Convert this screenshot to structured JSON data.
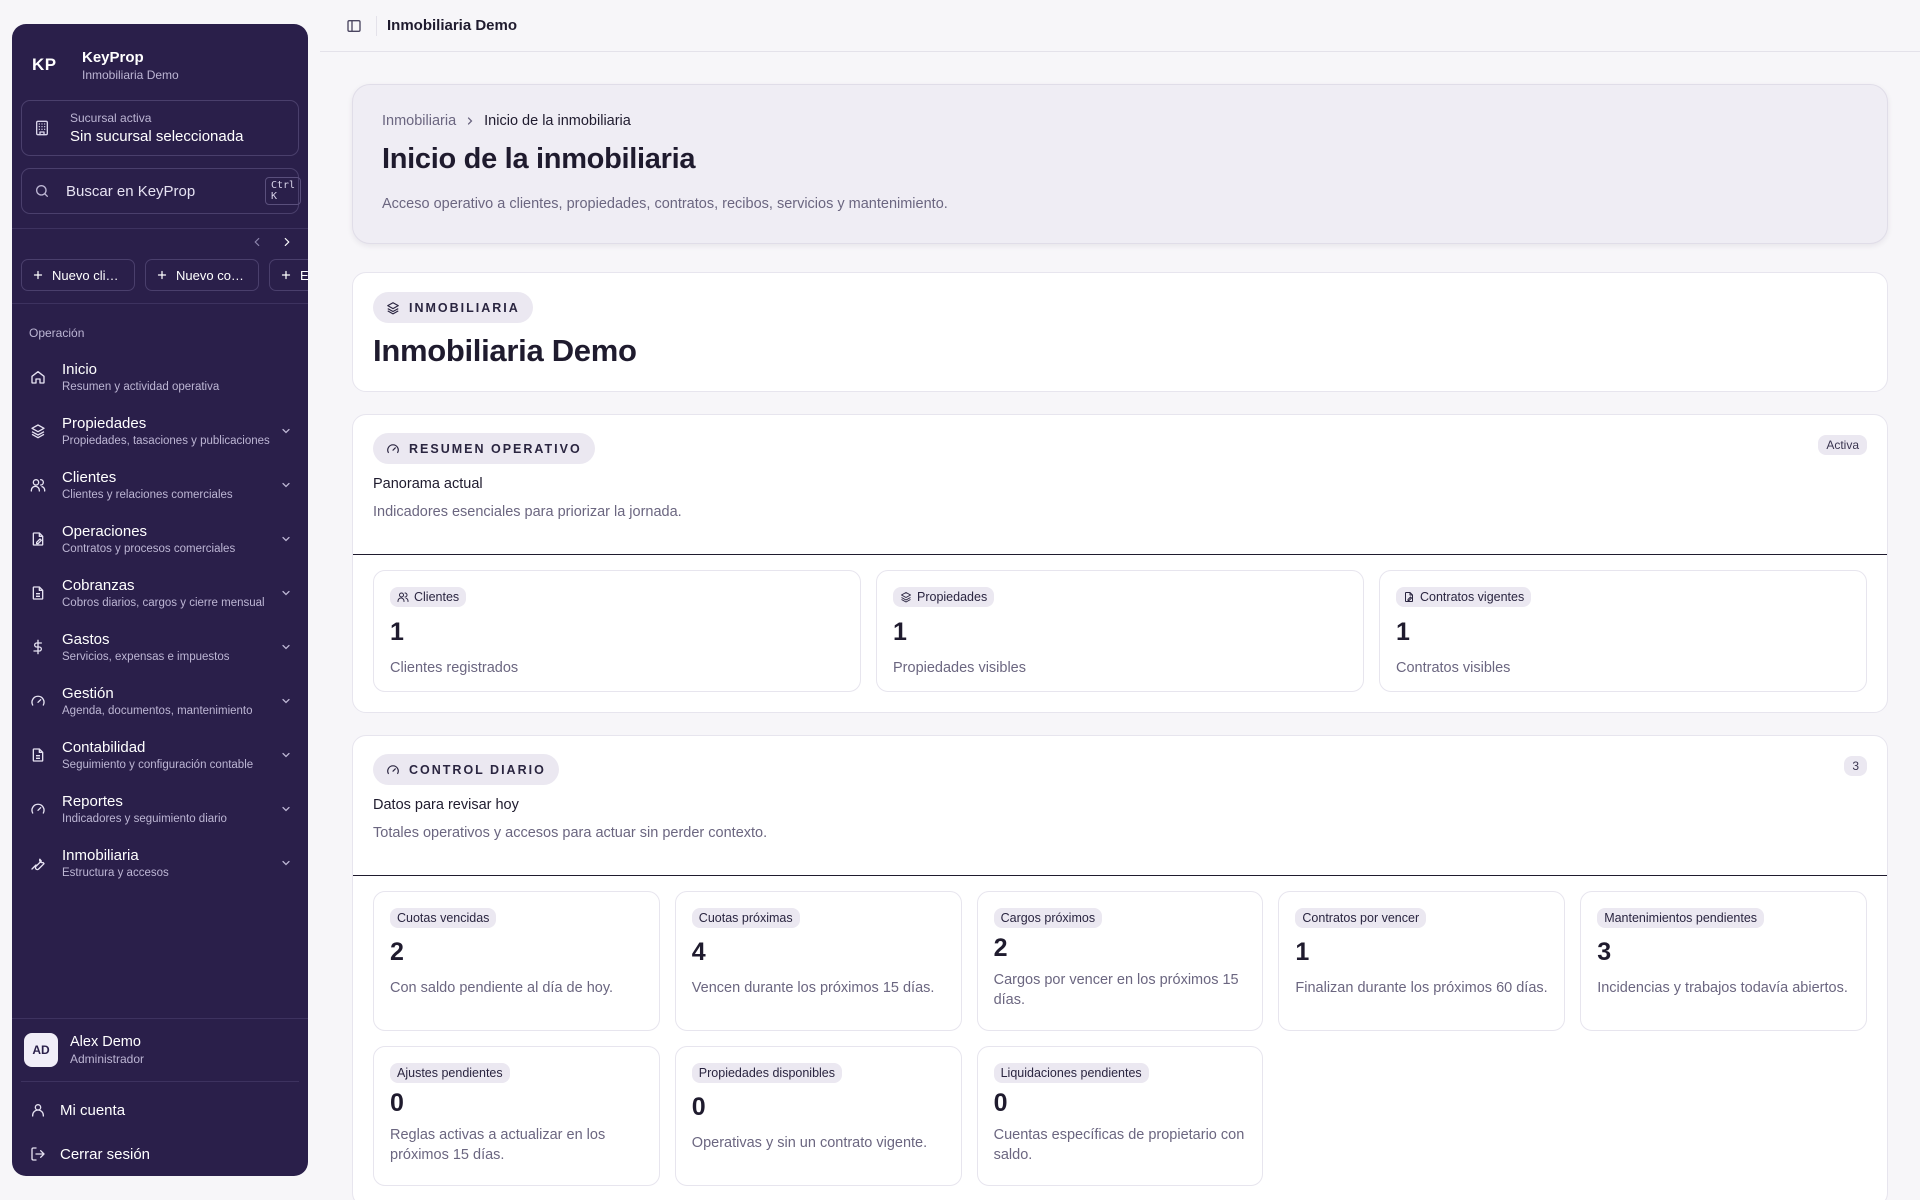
{
  "brand": {
    "logo": "KP",
    "name": "KeyProp",
    "company": "Inmobiliaria Demo"
  },
  "branch": {
    "label": "Sucursal activa",
    "value": "Sin sucursal seleccionada",
    "icon": "building-icon"
  },
  "search": {
    "placeholder": "Buscar en KeyProp",
    "shortcut": "Ctrl K"
  },
  "quick_actions": [
    {
      "label": "Nuevo cliente"
    },
    {
      "label": "Nuevo contrato"
    },
    {
      "label": "Emitir recibo"
    }
  ],
  "nav_section": "Operación",
  "nav": [
    {
      "title": "Inicio",
      "subtitle": "Resumen y actividad operativa",
      "icon": "home-icon",
      "expandable": false
    },
    {
      "title": "Propiedades",
      "subtitle": "Propiedades, tasaciones y publicaciones",
      "icon": "layers-icon",
      "expandable": true
    },
    {
      "title": "Clientes",
      "subtitle": "Clientes y relaciones comerciales",
      "icon": "users-icon",
      "expandable": true
    },
    {
      "title": "Operaciones",
      "subtitle": "Contratos y procesos comerciales",
      "icon": "file-edit-icon",
      "expandable": true
    },
    {
      "title": "Cobranzas",
      "subtitle": "Cobros diarios, cargos y cierre mensual",
      "icon": "file-text-icon",
      "expandable": true
    },
    {
      "title": "Gastos",
      "subtitle": "Servicios, expensas e impuestos",
      "icon": "dollar-icon",
      "expandable": true
    },
    {
      "title": "Gestión",
      "subtitle": "Agenda, documentos, mantenimiento",
      "icon": "gauge-icon",
      "expandable": true
    },
    {
      "title": "Contabilidad",
      "subtitle": "Seguimiento y configuración contable",
      "icon": "file-text-icon",
      "expandable": true
    },
    {
      "title": "Reportes",
      "subtitle": "Indicadores y seguimiento diario",
      "icon": "gauge-icon",
      "expandable": true
    },
    {
      "title": "Inmobiliaria",
      "subtitle": "Estructura y accesos",
      "icon": "wrench-icon",
      "expandable": true
    }
  ],
  "user": {
    "initials": "AD",
    "name": "Alex Demo",
    "role": "Administrador"
  },
  "account_links": {
    "my_account": "Mi cuenta",
    "logout": "Cerrar sesión"
  },
  "topbar": {
    "title": "Inmobiliaria Demo"
  },
  "page": {
    "breadcrumb_root": "Inmobiliaria",
    "breadcrumb_current": "Inicio de la inmobiliaria",
    "title": "Inicio de la inmobiliaria",
    "subtitle": "Acceso operativo a clientes, propiedades, contratos, recibos, servicios y mantenimiento."
  },
  "company_card": {
    "tag": "INMOBILIARIA",
    "name": "Inmobiliaria Demo"
  },
  "resumen": {
    "tag": "RESUMEN OPERATIVO",
    "badge": "Activa",
    "title": "Panorama actual",
    "subtitle": "Indicadores esenciales para priorizar la jornada.",
    "stats": [
      {
        "label": "Clientes",
        "icon": "users-icon",
        "value": "1",
        "desc": "Clientes registrados"
      },
      {
        "label": "Propiedades",
        "icon": "layers-icon",
        "value": "1",
        "desc": "Propiedades visibles"
      },
      {
        "label": "Contratos vigentes",
        "icon": "file-edit-icon",
        "value": "1",
        "desc": "Contratos visibles"
      }
    ]
  },
  "control": {
    "tag": "CONTROL DIARIO",
    "badge": "3",
    "title": "Datos para revisar hoy",
    "subtitle": "Totales operativos y accesos para actuar sin perder contexto.",
    "stats": [
      {
        "label": "Cuotas vencidas",
        "value": "2",
        "desc": "Con saldo pendiente al día de hoy."
      },
      {
        "label": "Cuotas próximas",
        "value": "4",
        "desc": "Vencen durante los próximos 15 días."
      },
      {
        "label": "Cargos próximos",
        "value": "2",
        "desc": "Cargos por vencer en los próximos 15 días."
      },
      {
        "label": "Contratos por vencer",
        "value": "1",
        "desc": "Finalizan durante los próximos 60 días."
      },
      {
        "label": "Mantenimientos pendientes",
        "value": "3",
        "desc": "Incidencias y trabajos todavía abiertos."
      },
      {
        "label": "Ajustes pendientes",
        "value": "0",
        "desc": "Reglas activas a actualizar en los próximos 15 días."
      },
      {
        "label": "Propiedades disponibles",
        "value": "0",
        "desc": "Operativas y sin un contrato vigente."
      },
      {
        "label": "Liquidaciones pendientes",
        "value": "0",
        "desc": "Cuentas específicas de propietario con saldo."
      }
    ]
  }
}
